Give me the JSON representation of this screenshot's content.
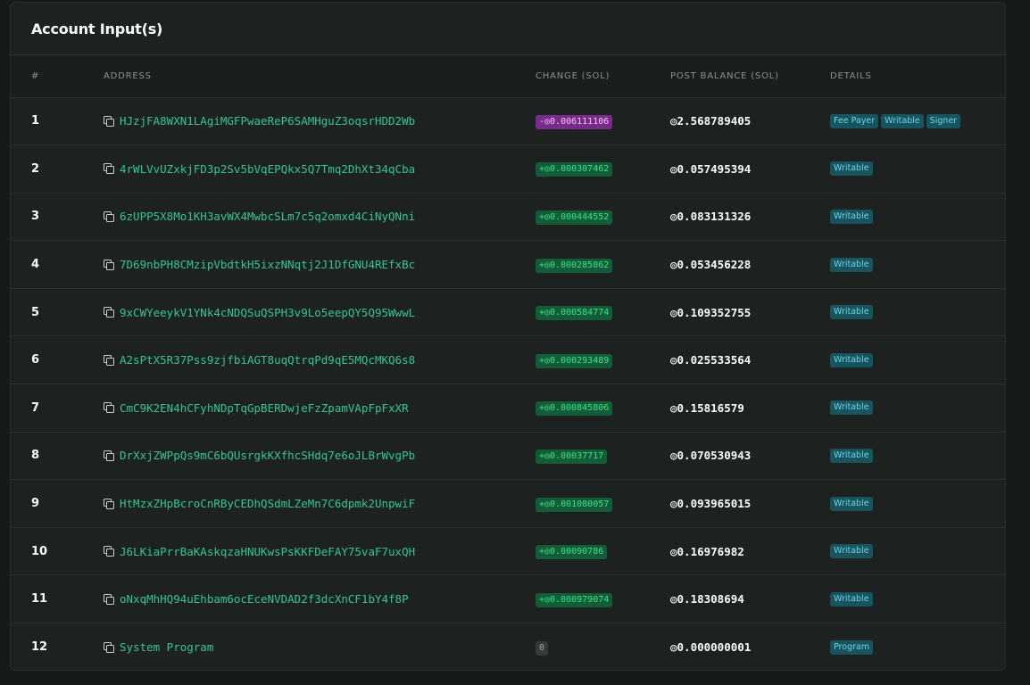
{
  "card": {
    "title": "Account Input(s)"
  },
  "table": {
    "columns": [
      "#",
      "Address",
      "Change (SOL)",
      "Post Balance (SOL)",
      "Details"
    ],
    "rows": [
      {
        "num": "1",
        "address": "HJzjFA8WXN1LAgiMGFPwaeReP6SAMHguZ3oqsrHDD2Wb",
        "change": "-◎0.006111106",
        "change_type": "neg",
        "balance": "◎2.568789405",
        "details": [
          "Fee Payer",
          "Writable",
          "Signer"
        ]
      },
      {
        "num": "2",
        "address": "4rWLVvUZxkjFD3p2Sv5bVqEPQkx5Q7Tmq2DhXt34qCba",
        "change": "+◎0.000307462",
        "change_type": "pos",
        "balance": "◎0.057495394",
        "details": [
          "Writable"
        ]
      },
      {
        "num": "3",
        "address": "6zUPP5X8Mo1KH3avWX4MwbcSLm7c5q2omxd4CiNyQNni",
        "change": "+◎0.000444552",
        "change_type": "pos",
        "balance": "◎0.083131326",
        "details": [
          "Writable"
        ]
      },
      {
        "num": "4",
        "address": "7D69nbPH8CMzipVbdtkH5ixzNNqtj2J1DfGNU4REfxBc",
        "change": "+◎0.000285862",
        "change_type": "pos",
        "balance": "◎0.053456228",
        "details": [
          "Writable"
        ]
      },
      {
        "num": "5",
        "address": "9xCWYeeykV1YNk4cNDQSuQSPH3v9Lo5eepQY5Q95WwwL",
        "change": "+◎0.000584774",
        "change_type": "pos",
        "balance": "◎0.109352755",
        "details": [
          "Writable"
        ]
      },
      {
        "num": "6",
        "address": "A2sPtX5R37Pss9zjfbiAGT8uqQtrqPd9qE5MQcMKQ6s8",
        "change": "+◎0.000293489",
        "change_type": "pos",
        "balance": "◎0.025533564",
        "details": [
          "Writable"
        ]
      },
      {
        "num": "7",
        "address": "CmC9K2EN4hCFyhNDpTqGpBERDwjeFzZpamVApFpFxXR",
        "change": "+◎0.000845806",
        "change_type": "pos",
        "balance": "◎0.15816579",
        "details": [
          "Writable"
        ]
      },
      {
        "num": "8",
        "address": "DrXxjZWPpQs9mC6bQUsrgkKXfhcSHdq7e6oJLBrWvgPb",
        "change": "+◎0.00037717",
        "change_type": "pos",
        "balance": "◎0.070530943",
        "details": [
          "Writable"
        ]
      },
      {
        "num": "9",
        "address": "HtMzxZHpBcroCnRByCEDhQSdmLZeMn7C6dpmk2UnpwiF",
        "change": "+◎0.001080057",
        "change_type": "pos",
        "balance": "◎0.093965015",
        "details": [
          "Writable"
        ]
      },
      {
        "num": "10",
        "address": "J6LKiaPrrBaKAskqzaHNUKwsPsKKFDeFAY75vaF7uxQH",
        "change": "+◎0.00090786",
        "change_type": "pos",
        "balance": "◎0.16976982",
        "details": [
          "Writable"
        ]
      },
      {
        "num": "11",
        "address": "oNxqMhHQ94uEhbam6ocEceNVDAD2f3dcXnCF1bY4f8P",
        "change": "+◎0.000979074",
        "change_type": "pos",
        "balance": "◎0.18308694",
        "details": [
          "Writable"
        ]
      },
      {
        "num": "12",
        "address": "System Program",
        "change": "0",
        "change_type": "zero",
        "balance": "◎0.000000001",
        "details": [
          "Program"
        ]
      }
    ]
  }
}
